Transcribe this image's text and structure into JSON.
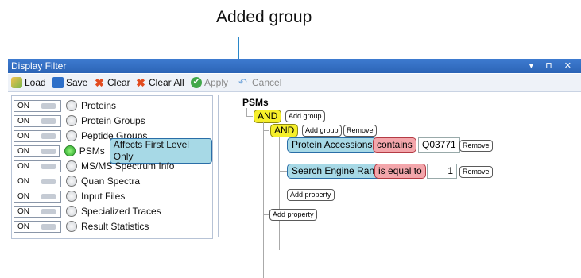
{
  "callout": {
    "text": "Added group"
  },
  "window": {
    "title": "Display Filter",
    "controls": "▾ ⊓ ✕"
  },
  "toolbar": {
    "load": "Load",
    "save": "Save",
    "clear": "Clear",
    "clear_all": "Clear All",
    "apply": "Apply",
    "cancel": "Cancel"
  },
  "levels": [
    {
      "toggle": "ON",
      "label": "Proteins",
      "active": false
    },
    {
      "toggle": "ON",
      "label": "Protein Groups",
      "active": false
    },
    {
      "toggle": "ON",
      "label": "Peptide Groups",
      "active": false
    },
    {
      "toggle": "ON",
      "label": "PSMs",
      "active": true,
      "badge": "Affects First Level Only"
    },
    {
      "toggle": "ON",
      "label": "MS/MS Spectrum Info",
      "active": false
    },
    {
      "toggle": "ON",
      "label": "Quan Spectra",
      "active": false
    },
    {
      "toggle": "ON",
      "label": "Input Files",
      "active": false
    },
    {
      "toggle": "ON",
      "label": "Specialized Traces",
      "active": false
    },
    {
      "toggle": "ON",
      "label": "Result Statistics",
      "active": false
    }
  ],
  "filter": {
    "root": "PSMs",
    "and1": "AND",
    "add_group": "Add group",
    "and2": "AND",
    "add_group_2": "Add group",
    "remove": "Remove",
    "conditions": [
      {
        "property": "Protein Accessions",
        "operator": "contains",
        "value": "Q03771",
        "remove": "Remove"
      },
      {
        "property": "Search Engine Rank",
        "operator": "is equal to",
        "value": "1",
        "remove": "Remove"
      }
    ],
    "add_property_inner": "Add property",
    "add_property_outer": "Add property"
  },
  "colors": {
    "titlebar": "#2b64b6",
    "and_fill": "#f6ef2b",
    "property_fill": "#a7d9e6",
    "operator_fill": "#f3a6ab",
    "active_radio": "#2ea82b"
  }
}
